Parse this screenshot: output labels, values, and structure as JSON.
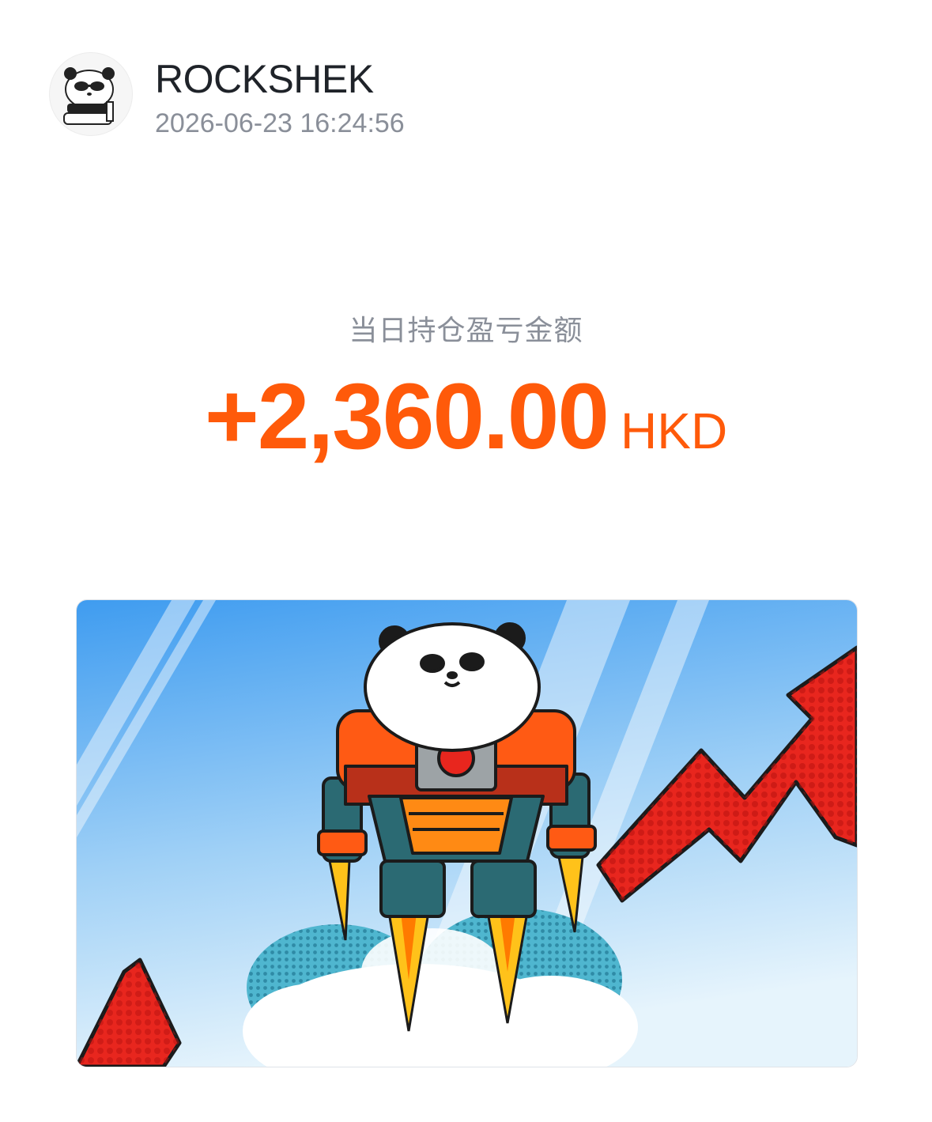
{
  "post": {
    "author": "ROCKSHEK",
    "timestamp": "2026-06-23 16:24:56"
  },
  "pnl": {
    "label": "当日持仓盈亏金额",
    "amount": "+2,360.00",
    "currency": "HKD",
    "color": "#ff5a0a"
  },
  "banner": {
    "icon": "panda-rocket-illustration",
    "sky_top": "#4aa3f0",
    "sky_bottom": "#dff0fb",
    "arrow_color": "#e8261e",
    "flame_color": "#ffc21a"
  },
  "avatar": {
    "icon": "panda-avatar-icon"
  }
}
